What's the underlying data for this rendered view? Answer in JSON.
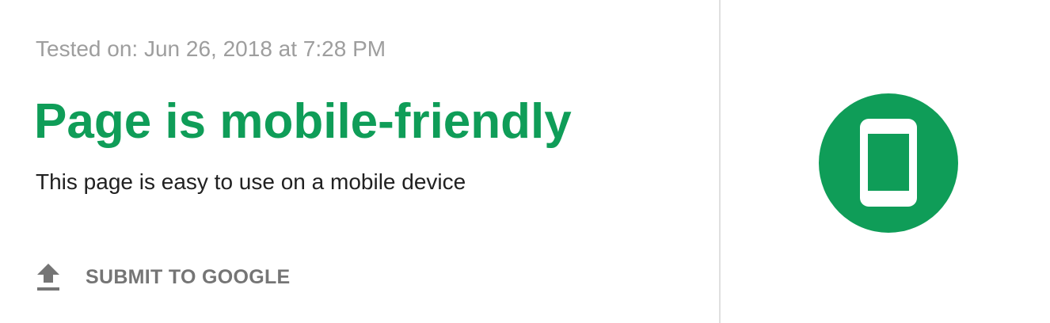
{
  "result": {
    "tested_on": "Tested on: Jun 26, 2018 at 7:28 PM",
    "title": "Page is mobile-friendly",
    "description": "This page is easy to use on a mobile device"
  },
  "actions": {
    "submit_label": "SUBMIT TO GOOGLE",
    "submit_icon": "upload-icon"
  },
  "badge": {
    "icon": "mobile-phone-icon",
    "color": "#0f9d58"
  },
  "colors": {
    "accent": "#0f9d58",
    "muted_text": "#9e9e9e",
    "body_text": "#212121",
    "action_text": "#757575"
  }
}
